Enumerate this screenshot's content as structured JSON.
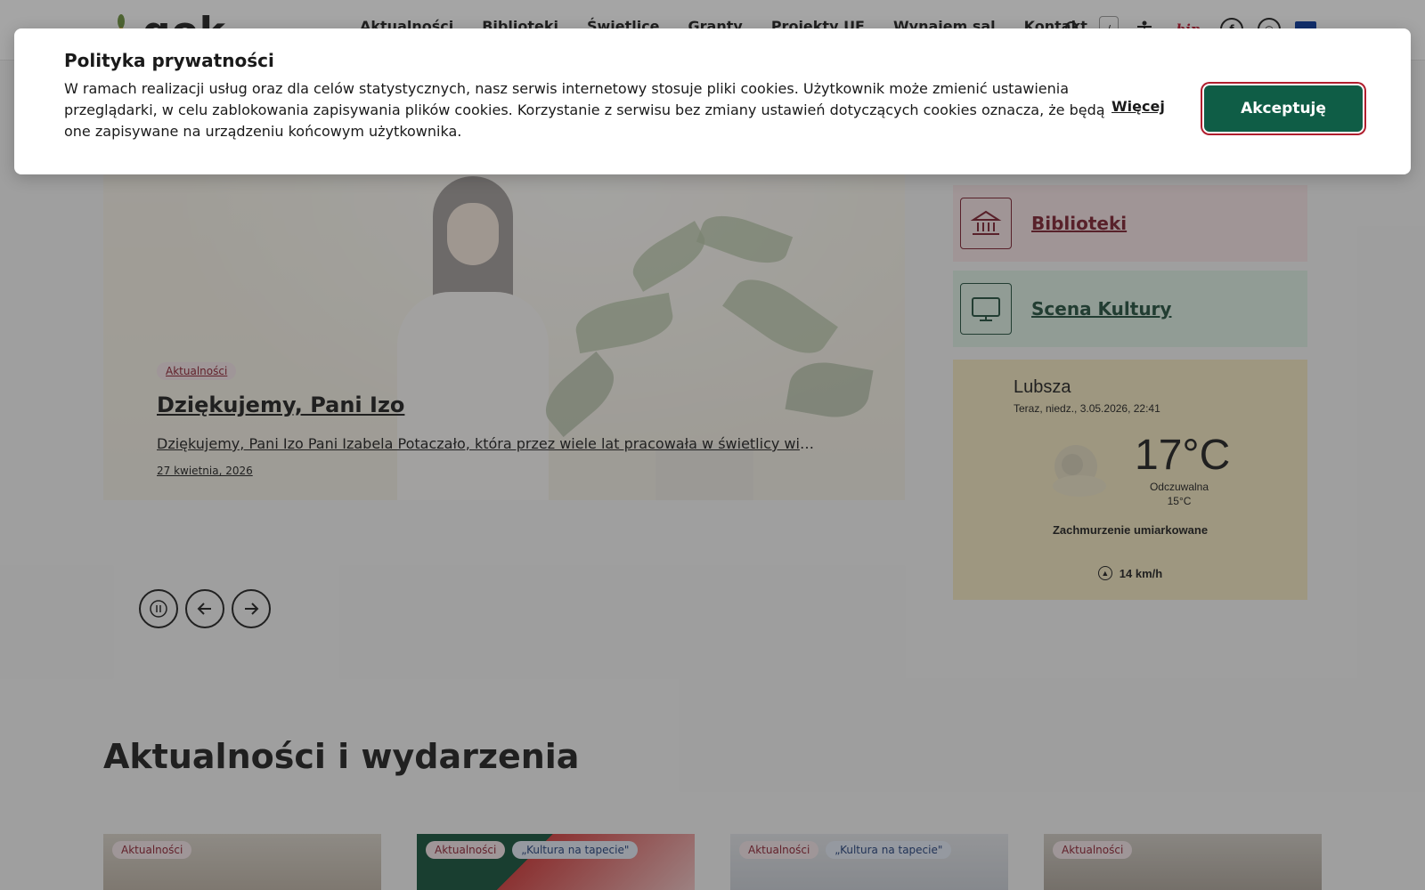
{
  "header": {
    "logo_text": "gok",
    "nav": [
      "Aktualności",
      "Biblioteki",
      "Świetlice",
      "Granty",
      "Projekty UE",
      "Wynajem sal",
      "Kontakt"
    ],
    "lang_label": "/",
    "bip_label": "bip"
  },
  "hero": {
    "tag": "Aktualności",
    "title": "Dziękujemy, Pani Izo",
    "excerpt": "Dziękujemy, Pani Izo Pani Izabela Potaczało, która przez wiele lat pracowała w świetlicy wiejskiej w…",
    "date": "27 kwietnia, 2026"
  },
  "tiles": {
    "biblioteki": "Biblioteki",
    "scena": "Scena Kultury"
  },
  "weather": {
    "city": "Lubsza",
    "now": "Teraz, niedz., 3.05.2026, 22:41",
    "temp": "17°C",
    "feels_label": "Odczuwalna",
    "feels_value": "15°C",
    "description": "Zachmurzenie umiarkowane",
    "wind": "14 km/h"
  },
  "news": {
    "title": "Aktualności i wydarzenia",
    "cards": [
      {
        "tags": [
          "Aktualności"
        ]
      },
      {
        "tags": [
          "Aktualności",
          "„Kultura na tapecie\""
        ]
      },
      {
        "tags": [
          "Aktualności",
          "„Kultura na tapecie\""
        ]
      },
      {
        "tags": [
          "Aktualności"
        ]
      }
    ]
  },
  "cookie": {
    "title": "Polityka prywatności",
    "text": "W ramach realizacji usług oraz dla celów statystycznych, nasz serwis internetowy stosuje pliki cookies. Użytkownik może zmienić ustawienia przeglądarki, w celu zablokowania zapisywania plików cookies. Korzystanie z serwisu bez zmiany ustawień dotyczących cookies oznacza, że będą one zapisywane na urządzeniu końcowym użytkownika.",
    "more_label": "Więcej",
    "accept_label": "Akceptuję"
  },
  "colors": {
    "accent_green": "#0f5d46",
    "accent_red": "#7a1c2b",
    "weather_bg": "#f3e7bf"
  },
  "icons": [
    "search-icon",
    "accessibility-icon",
    "facebook-icon",
    "instagram-icon",
    "eu-flag-icon",
    "library-icon",
    "monitor-icon",
    "cloud-icon",
    "wind-icon",
    "pause-icon",
    "arrow-left-icon",
    "arrow-right-icon"
  ]
}
